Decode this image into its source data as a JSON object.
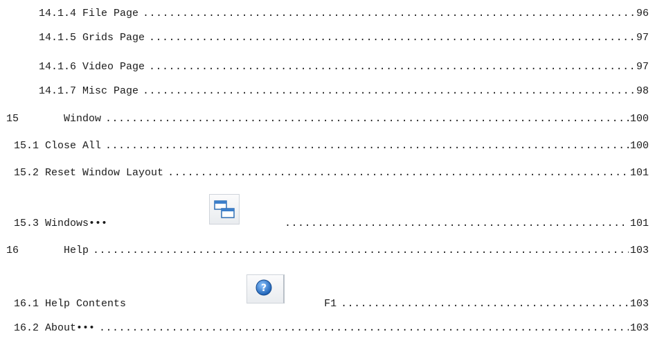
{
  "toc": [
    {
      "number": "14.1.4",
      "title": "File Page",
      "page": "96"
    },
    {
      "number": "14.1.5",
      "title": "Grids Page",
      "page": "97"
    },
    {
      "number": "14.1.6",
      "title": "Video Page",
      "page": "97"
    },
    {
      "number": "14.1.7",
      "title": "Misc Page",
      "page": "98"
    },
    {
      "number": "15",
      "title": "Window",
      "page": "100"
    },
    {
      "number": "15.1",
      "title": "Close All",
      "page": "100"
    },
    {
      "number": "15.2",
      "title": "Reset Window Layout",
      "page": "101"
    },
    {
      "number": "15.3",
      "title": "Windows•••",
      "page": "101",
      "icon": "windows-cascade-icon"
    },
    {
      "number": "16",
      "title": "Help",
      "page": "103"
    },
    {
      "number": "16.1",
      "title": "Help Contents",
      "page": "103",
      "icon": "help-question-icon",
      "shortcut": "F1"
    },
    {
      "number": "16.2",
      "title": "About•••",
      "page": "103"
    }
  ]
}
